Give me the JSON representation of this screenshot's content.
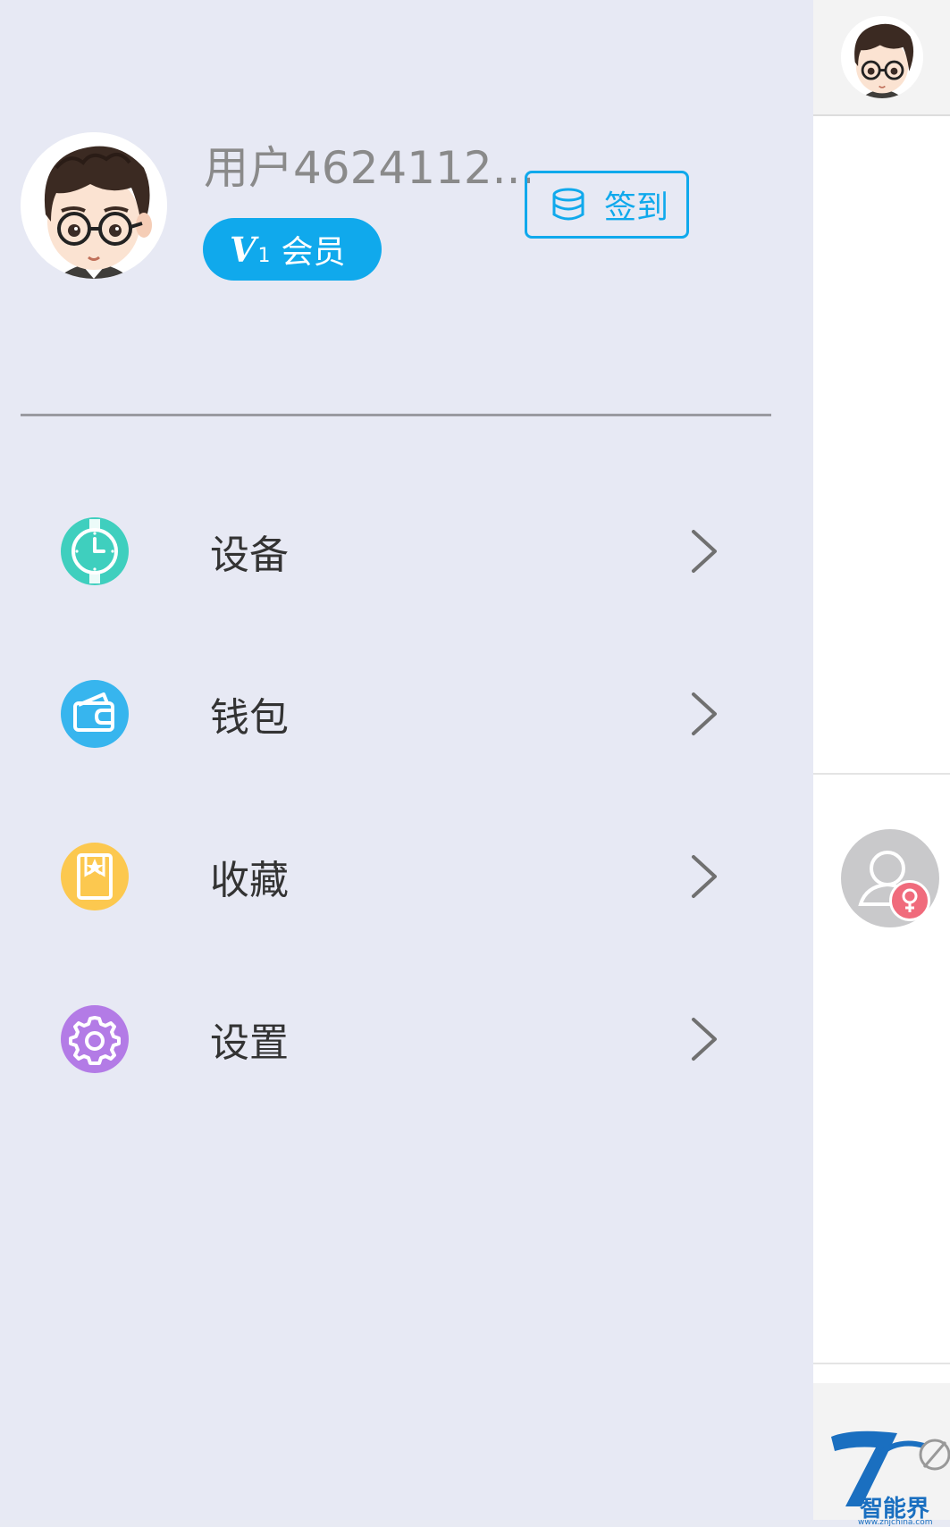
{
  "drawer": {
    "user": {
      "name": "用户4624112...",
      "avatar_icon": "cartoon-boy-avatar"
    },
    "member_badge": {
      "level_letter": "V",
      "level_number": "1",
      "label": "会员"
    },
    "checkin": {
      "label": "签到",
      "icon": "coin-stack-icon"
    },
    "menu": [
      {
        "label": "设备",
        "icon": "watch-icon",
        "color": "#3fcfbe"
      },
      {
        "label": "钱包",
        "icon": "wallet-icon",
        "color": "#37b5ee"
      },
      {
        "label": "收藏",
        "icon": "bookmark-star-icon",
        "color": "#fcc84f"
      },
      {
        "label": "设置",
        "icon": "gear-icon",
        "color": "#b37be6"
      }
    ]
  },
  "background_page": {
    "watermark": {
      "brand": "智能界",
      "url": "www.znjchina.com"
    }
  },
  "colors": {
    "accent": "#10a9ec",
    "drawer_bg": "#e7e9f4",
    "female_badge": "#f06b7c"
  }
}
